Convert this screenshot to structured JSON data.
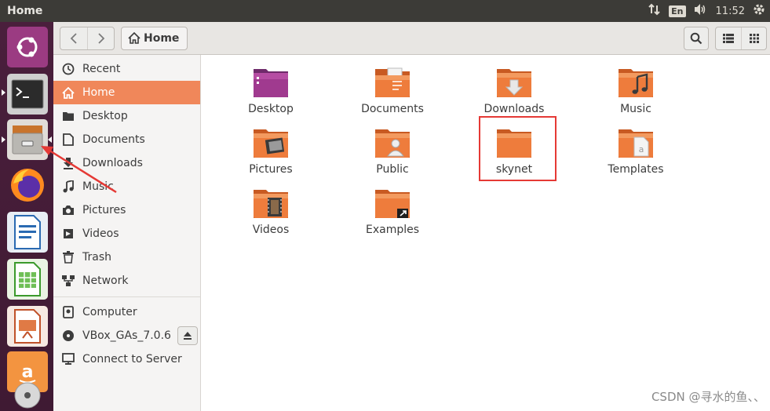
{
  "window": {
    "title": "Home"
  },
  "top_panel": {
    "lang": "En",
    "time": "11:52"
  },
  "header": {
    "path_label": "Home"
  },
  "sidebar": {
    "items": [
      {
        "label": "Recent",
        "icon": "clock-icon"
      },
      {
        "label": "Home",
        "icon": "home-icon",
        "active": true
      },
      {
        "label": "Desktop",
        "icon": "folder-icon"
      },
      {
        "label": "Documents",
        "icon": "document-icon"
      },
      {
        "label": "Downloads",
        "icon": "download-icon"
      },
      {
        "label": "Music",
        "icon": "music-icon"
      },
      {
        "label": "Pictures",
        "icon": "camera-icon"
      },
      {
        "label": "Videos",
        "icon": "film-icon"
      },
      {
        "label": "Trash",
        "icon": "trash-icon"
      },
      {
        "label": "Network",
        "icon": "network-icon"
      }
    ],
    "devices": [
      {
        "label": "Computer",
        "icon": "computer-icon"
      },
      {
        "label": "VBox_GAs_7.0.6",
        "icon": "disc-icon"
      },
      {
        "label": "Connect to Server",
        "icon": "server-icon"
      }
    ]
  },
  "folders": [
    {
      "label": "Desktop",
      "kind": "desktop"
    },
    {
      "label": "Documents",
      "kind": "documents"
    },
    {
      "label": "Downloads",
      "kind": "downloads"
    },
    {
      "label": "Music",
      "kind": "music"
    },
    {
      "label": "Pictures",
      "kind": "pictures"
    },
    {
      "label": "Public",
      "kind": "public"
    },
    {
      "label": "skynet",
      "kind": "plain"
    },
    {
      "label": "Templates",
      "kind": "templates"
    },
    {
      "label": "Videos",
      "kind": "videos"
    },
    {
      "label": "Examples",
      "kind": "examples"
    }
  ],
  "watermark": "CSDN @寻水的鱼、、",
  "colors": {
    "accent": "#f0875a",
    "launcher": "#4a1f3c",
    "panel": "#3c3b37",
    "highlight": "#e53935"
  }
}
